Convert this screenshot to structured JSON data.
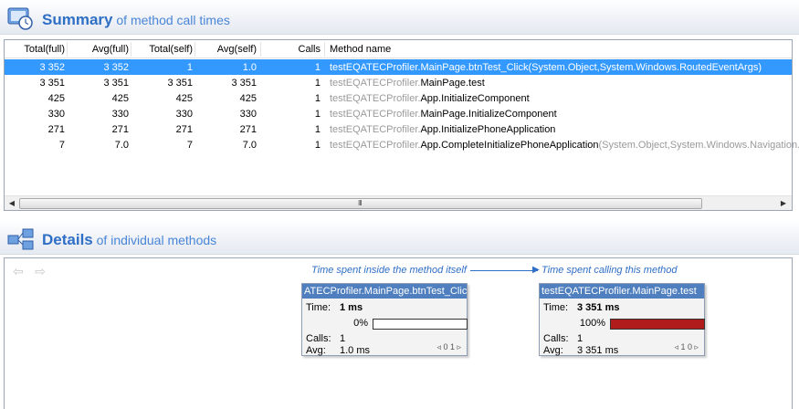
{
  "summary": {
    "title_bold": "Summary",
    "title_rest": " of method call times",
    "columns": [
      "Total(full)",
      "Avg(full)",
      "Total(self)",
      "Avg(self)",
      "Calls",
      "Method name"
    ],
    "rows": [
      {
        "total_full": "3 352",
        "avg_full": "3 352",
        "total_self": "1",
        "avg_self": "1.0",
        "calls": "1",
        "ns": "testEQATECProfiler.",
        "method": "MainPage.btnTest_Click",
        "args": "(System.Object,System.Windows.RoutedEventArgs)",
        "selected": true
      },
      {
        "total_full": "3 351",
        "avg_full": "3 351",
        "total_self": "3 351",
        "avg_self": "3 351",
        "calls": "1",
        "ns": "testEQATECProfiler.",
        "method": "MainPage.test",
        "args": ""
      },
      {
        "total_full": "425",
        "avg_full": "425",
        "total_self": "425",
        "avg_self": "425",
        "calls": "1",
        "ns": "testEQATECProfiler.",
        "method": "App.InitializeComponent",
        "args": ""
      },
      {
        "total_full": "330",
        "avg_full": "330",
        "total_self": "330",
        "avg_self": "330",
        "calls": "1",
        "ns": "testEQATECProfiler.",
        "method": "MainPage.InitializeComponent",
        "args": ""
      },
      {
        "total_full": "271",
        "avg_full": "271",
        "total_self": "271",
        "avg_self": "271",
        "calls": "1",
        "ns": "testEQATECProfiler.",
        "method": "App.InitializePhoneApplication",
        "args": ""
      },
      {
        "total_full": "7",
        "avg_full": "7.0",
        "total_self": "7",
        "avg_self": "7.0",
        "calls": "1",
        "ns": "testEQATECProfiler.",
        "method": "App.CompleteInitializePhoneApplication",
        "args": "(System.Object,System.Windows.Navigation.Na"
      }
    ],
    "scroll_grip": "III"
  },
  "details": {
    "title_bold": "Details",
    "title_rest": " of individual methods",
    "caption_left": "Time spent inside the method itself",
    "caption_right": "Time spent calling this method",
    "left_card": {
      "title": "ATECProfiler.MainPage.btnTest_Click",
      "time_label": "Time:",
      "time_value": "1 ms",
      "percent": "0%",
      "percent_value": 0,
      "calls_label": "Calls:",
      "calls_value": "1",
      "avg_label": "Avg:",
      "avg_value": "1.0 ms",
      "pager": "◃ 0 1 ▹"
    },
    "right_card": {
      "title": "testEQATECProfiler.MainPage.test",
      "time_label": "Time:",
      "time_value": "3 351 ms",
      "percent": "100%",
      "percent_value": 100,
      "calls_label": "Calls:",
      "calls_value": "1",
      "avg_label": "Avg:",
      "avg_value": "3 351 ms",
      "pager": "◃ 1 0 ▹"
    }
  },
  "colors": {
    "accent": "#3a7bd5",
    "selection": "#3399ff",
    "bar_fill": "#b01c1c",
    "card_title": "#4f7fbf"
  }
}
